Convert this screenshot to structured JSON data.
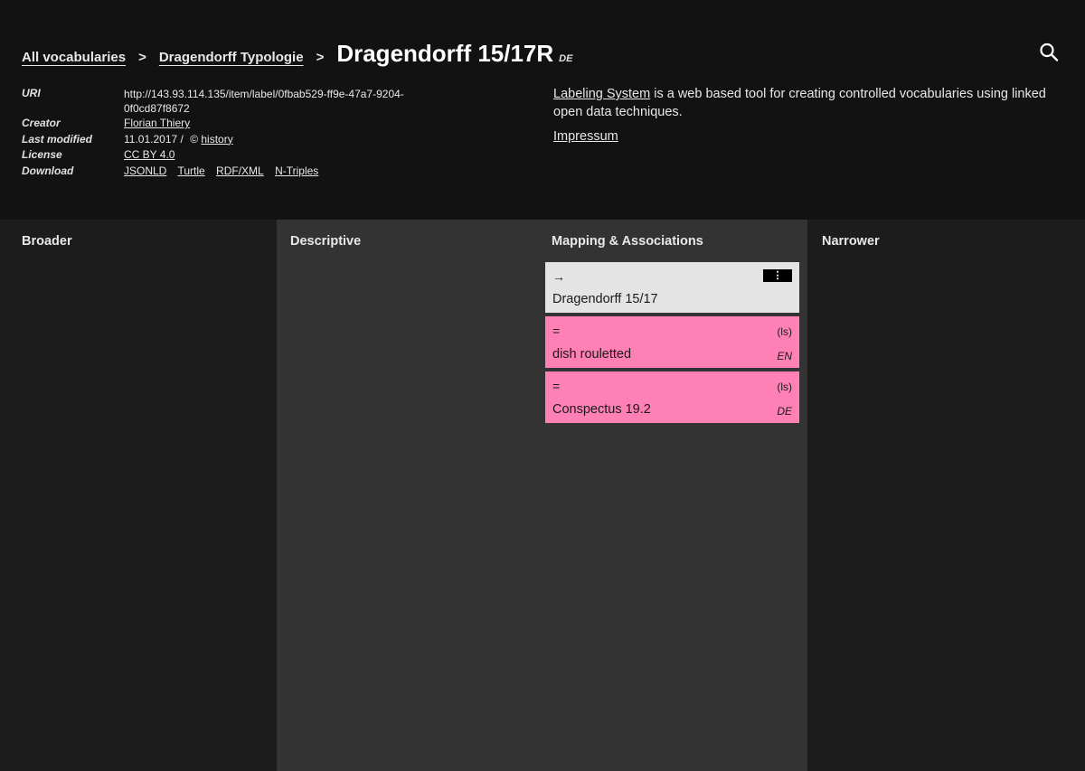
{
  "breadcrumb": {
    "items": [
      "All vocabularies",
      "Dragendorff Typologie"
    ],
    "separator": ">",
    "current_title": "Dragendorff 15/17R",
    "current_lang": "DE"
  },
  "icons": {
    "search": "search-icon",
    "menu": "vertical-dots-icon",
    "history": "copyright-icon"
  },
  "metadata": {
    "uri_label": "URI",
    "uri_value": "http://143.93.114.135/item/label/0fbab529-ff9e-47a7-9204-0f0cd87f8672",
    "creator_label": "Creator",
    "creator_value": "Florian Thiery",
    "modified_label": "Last modified",
    "modified_value": "11.01.2017 /",
    "history_icon": "©",
    "history_link": "history",
    "license_label": "License",
    "license_value": "CC BY 4.0",
    "download_label": "Download",
    "download_links": [
      "JSONLD",
      "Turtle",
      "RDF/XML",
      "N-Triples"
    ]
  },
  "about": {
    "link_text": "Labeling System",
    "description": " is a web based tool for creating controlled vocabularies using linked open data techniques.",
    "impressum": "Impressum"
  },
  "columns": {
    "broader": "Broader",
    "descriptive": "Descriptive",
    "mapping": "Mapping & Associations",
    "narrower": "Narrower"
  },
  "mappings": [
    {
      "relation": "→",
      "label": "Dragendorff 15/17",
      "menu": "⋮"
    },
    {
      "relation": "=",
      "label": "dish rouletted",
      "source": "(ls)",
      "lang": "EN"
    },
    {
      "relation": "=",
      "label": "Conspectus 19.2",
      "source": "(ls)",
      "lang": "DE"
    }
  ],
  "colors": {
    "header_bg": "#121212",
    "page_bg": "#1c1c1c",
    "middle_col_bg": "#333333",
    "card_grey": "#e4e4e4",
    "card_pink": "#ff80b5"
  }
}
